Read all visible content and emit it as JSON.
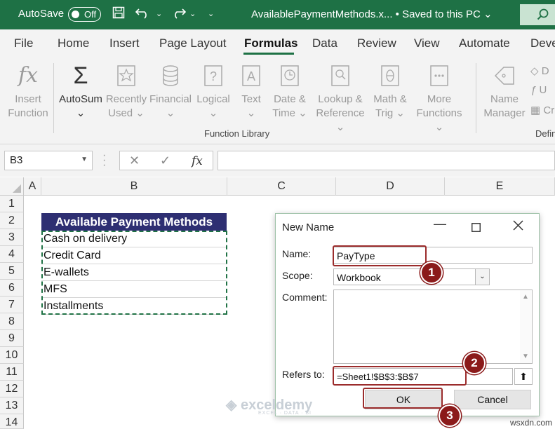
{
  "titlebar": {
    "autosave_label": "AutoSave",
    "toggle_state": "Off",
    "file_title": "AvailablePaymentMethods.x...  •  Saved to this PC  ⌄"
  },
  "tabs": [
    "File",
    "Home",
    "Insert",
    "Page Layout",
    "Formulas",
    "Data",
    "Review",
    "View",
    "Automate",
    "Deve"
  ],
  "active_tab": "Formulas",
  "ribbon": {
    "insert_function": [
      "Insert",
      "Function"
    ],
    "autosum": [
      "AutoSum",
      "⌄"
    ],
    "recently_used": [
      "Recently",
      "Used ⌄"
    ],
    "financial": [
      "Financial",
      "⌄"
    ],
    "logical": [
      "Logical",
      "⌄"
    ],
    "text": [
      "Text",
      "⌄"
    ],
    "date_time": [
      "Date &",
      "Time ⌄"
    ],
    "lookup_reference": [
      "Lookup &",
      "Reference ⌄"
    ],
    "math_trig": [
      "Math &",
      "Trig ⌄"
    ],
    "more_functions": [
      "More",
      "Functions ⌄"
    ],
    "function_library_label": "Function Library",
    "name_manager": [
      "Name",
      "Manager"
    ],
    "define_group_label": "Defin",
    "small_items": [
      "D",
      "U",
      "Cr"
    ]
  },
  "formula_bar": {
    "name_box": "B3",
    "fx": "fx"
  },
  "grid": {
    "columns": [
      {
        "id": "A",
        "label": "A"
      },
      {
        "id": "B",
        "label": "B"
      },
      {
        "id": "C",
        "label": "C"
      },
      {
        "id": "D",
        "label": "D"
      },
      {
        "id": "E",
        "label": "E"
      }
    ],
    "rows": [
      "1",
      "2",
      "3",
      "4",
      "5",
      "6",
      "7",
      "8",
      "9",
      "10",
      "11",
      "12",
      "13",
      "14"
    ],
    "table_header": "Available Payment Methods",
    "cells": [
      "Cash on delivery",
      "Credit Card",
      "E-wallets",
      "MFS",
      "Installments"
    ]
  },
  "dialog": {
    "title": "New Name",
    "name_label": "Name:",
    "name_value": "PayType",
    "scope_label": "Scope:",
    "scope_value": "Workbook",
    "comment_label": "Comment:",
    "refers_label": "Refers to:",
    "refers_value": "=Sheet1!$B$3:$B$7",
    "ok_label": "OK",
    "cancel_label": "Cancel",
    "badges": [
      "1",
      "2",
      "3"
    ]
  },
  "watermark": {
    "brand": "exceldemy",
    "tagline": "EXCEL · DATA · BI"
  },
  "site": "wsxdn.com",
  "colors": {
    "excel_green": "#1e7145",
    "table_header_bg": "#2e2f72",
    "highlight_red": "#9b2c2c"
  }
}
